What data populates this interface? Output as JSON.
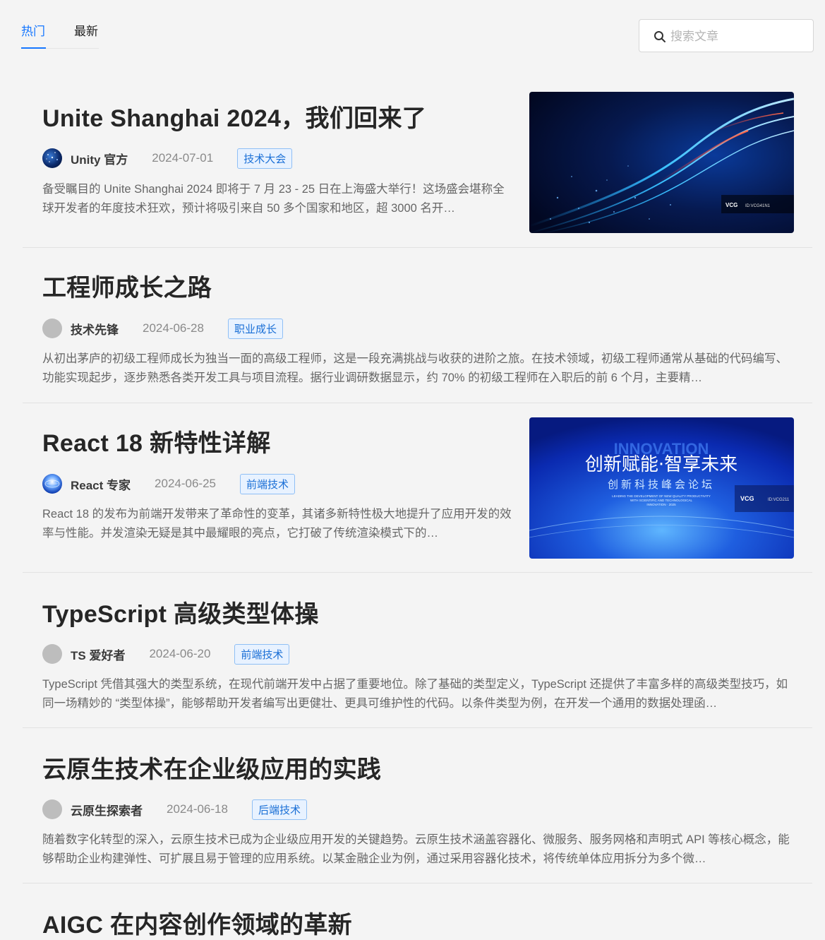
{
  "tabs": [
    {
      "label": "热门",
      "active": true
    },
    {
      "label": "最新",
      "active": false
    }
  ],
  "search": {
    "placeholder": "搜索文章",
    "value": ""
  },
  "colors": {
    "accent": "#1677ff",
    "tag_text": "#1a6fd6",
    "tag_bg": "#e8f2ff"
  },
  "articles": [
    {
      "title": "Unite Shanghai 2024，我们回来了",
      "author": "Unity 官方",
      "date": "2024-07-01",
      "tag": "技术大会",
      "excerpt": "备受瞩目的 Unite Shanghai 2024 即将于 7 月 23 - 25 日在上海盛大举行！这场盛会堪称全球开发者的年度技术狂欢，预计将吸引来自 50 多个国家和地区，超 3000 名开…",
      "avatar": "starfield",
      "thumbnail": {
        "style": "blue-light-streaks",
        "watermark": "VCG"
      }
    },
    {
      "title": "工程师成长之路",
      "author": "技术先锋",
      "date": "2024-06-28",
      "tag": "职业成长",
      "excerpt": "从初出茅庐的初级工程师成长为独当一面的高级工程师，这是一段充满挑战与收获的进阶之旅。在技术领域，初级工程师通常从基础的代码编写、功能实现起步，逐步熟悉各类开发工具与项目流程。据行业调研数据显示，约 70% 的初级工程师在入职后的前 6 个月，主要精…",
      "avatar": "placeholder"
    },
    {
      "title": "React 18 新特性详解",
      "author": "React 专家",
      "date": "2024-06-25",
      "tag": "前端技术",
      "excerpt": "React 18 的发布为前端开发带来了革命性的变革，其诸多新特性极大地提升了应用开发的效率与性能。并发渲染无疑是其中最耀眼的亮点，它打破了传统渲染模式下的…",
      "avatar": "globe",
      "thumbnail": {
        "style": "innovation-banner",
        "overlay": "INNOVATION",
        "heading": "创新赋能·智享未来",
        "subheading": "创新科技峰会论坛",
        "small_lines": [
          "LEADING THE DEVELOPMENT OF NEW QUALITY PRODUCTIVITY",
          "WITH SCIENTIFIC AND TECHNOLOGICAL",
          "INNOVATION · 2025"
        ],
        "watermark": "VCG"
      }
    },
    {
      "title": "TypeScript 高级类型体操",
      "author": "TS 爱好者",
      "date": "2024-06-20",
      "tag": "前端技术",
      "excerpt": "TypeScript 凭借其强大的类型系统，在现代前端开发中占据了重要地位。除了基础的类型定义，TypeScript 还提供了丰富多样的高级类型技巧，如同一场精妙的 “类型体操”，能够帮助开发者编写出更健壮、更具可维护性的代码。以条件类型为例，在开发一个通用的数据处理函…",
      "avatar": "placeholder"
    },
    {
      "title": "云原生技术在企业级应用的实践",
      "author": "云原生探索者",
      "date": "2024-06-18",
      "tag": "后端技术",
      "excerpt": "随着数字化转型的深入，云原生技术已成为企业级应用开发的关键趋势。云原生技术涵盖容器化、微服务、服务网格和声明式 API 等核心概念，能够帮助企业构建弹性、可扩展且易于管理的应用系统。以某金融企业为例，通过采用容器化技术，将传统单体应用拆分为多个微…",
      "avatar": "placeholder"
    },
    {
      "title": "AIGC 在内容创作领域的革新"
    }
  ]
}
